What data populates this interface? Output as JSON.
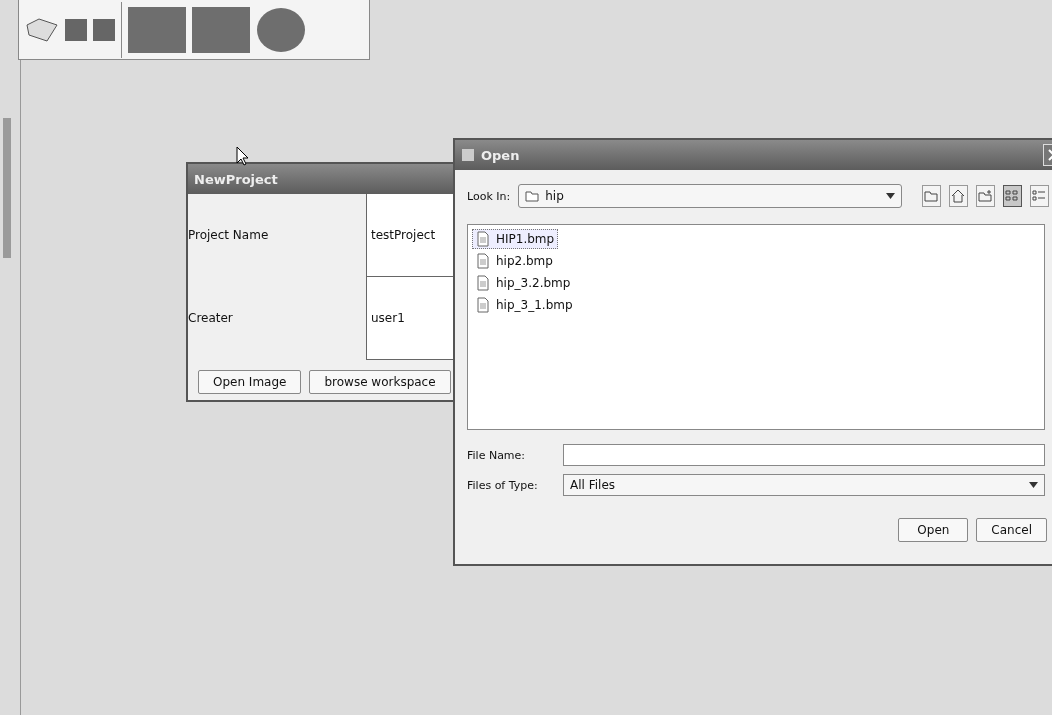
{
  "new_project_dialog": {
    "title": "NewProject",
    "fields": [
      {
        "label": "Project Name",
        "value": "testProject"
      },
      {
        "label": "Creater",
        "value": "user1"
      }
    ],
    "buttons": [
      "Open Image",
      "browse workspace"
    ]
  },
  "open_dialog": {
    "title": "Open",
    "look_in": {
      "label": "Look In:",
      "value": "hip"
    },
    "view_modes": [
      {
        "kind": "list",
        "selected": true
      },
      {
        "kind": "details",
        "selected": false
      }
    ],
    "files": [
      {
        "name": "HIP1.bmp",
        "selected": true
      },
      {
        "name": "hip2.bmp",
        "selected": false
      },
      {
        "name": "hip_3.2.bmp",
        "selected": false
      },
      {
        "name": "hip_3_1.bmp",
        "selected": false
      }
    ],
    "file_name": {
      "label": "File Name:"
    },
    "files_of_type": {
      "label": "Files of Type:",
      "value": "All Files"
    },
    "buttons": [
      "Open",
      "Cancel"
    ]
  }
}
